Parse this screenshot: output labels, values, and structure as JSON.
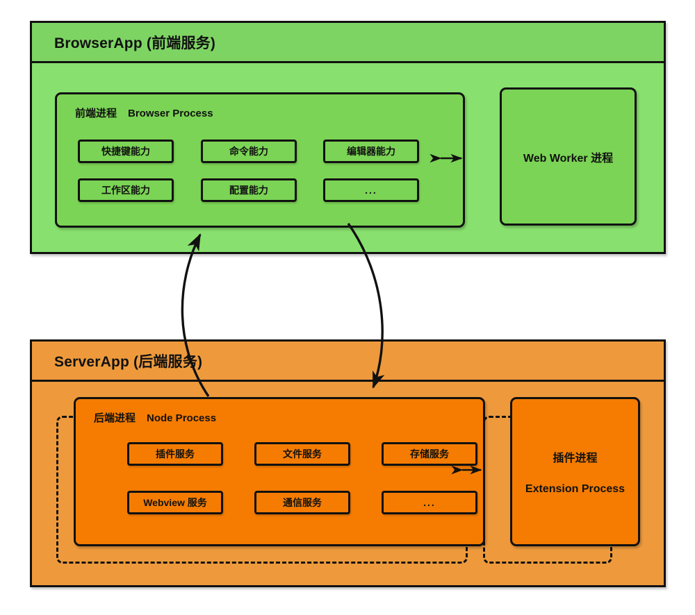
{
  "diagram": {
    "title": "BrowserApp / ServerApp process architecture",
    "colors": {
      "green_header": "#7ED463",
      "green_panel": "#88E06E",
      "green_process": "#7BD455",
      "orange_header": "#EE9A3C",
      "orange_panel": "#EE9A3C",
      "orange_process": "#F57C00",
      "stroke": "#111111"
    }
  },
  "browser_app": {
    "title": "BrowserApp (前端服务)",
    "process": {
      "title_cn": "前端进程",
      "title_en": "Browser Process",
      "capabilities": [
        "快捷键能力",
        "命令能力",
        "编辑器能力",
        "工作区能力",
        "配置能力",
        "..."
      ]
    },
    "worker": {
      "lines": [
        "Web Worker 进程"
      ]
    },
    "connector": {
      "icon": "double-arrow-horizontal"
    }
  },
  "server_app": {
    "title": "ServerApp (后端服务)",
    "process": {
      "title_cn": "后端进程",
      "title_en": "Node Process",
      "services": [
        "插件服务",
        "文件服务",
        "存储服务",
        "Webview 服务",
        "通信服务",
        "..."
      ]
    },
    "extension": {
      "lines": [
        "插件进程",
        "Extension Process"
      ]
    },
    "connector": {
      "icon": "double-arrow-horizontal"
    }
  },
  "connections": [
    {
      "id": "server-to-browser",
      "direction": "up",
      "style": "curved-arrow"
    },
    {
      "id": "browser-to-server",
      "direction": "down",
      "style": "curved-arrow"
    }
  ]
}
